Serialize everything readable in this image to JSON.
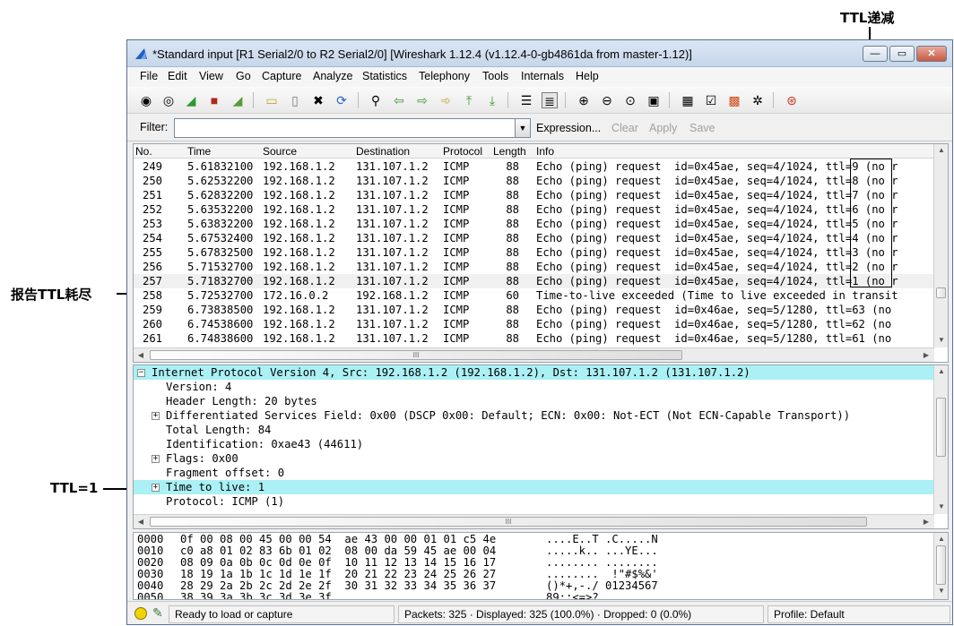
{
  "annotations": {
    "ttl_decrement": "TTL递减",
    "report_ttl_exhausted": "报告TTL耗尽",
    "ttl_equals_1": "TTL=1"
  },
  "window": {
    "title": "*Standard input   [R1 Serial2/0 to R2 Serial2/0]   [Wireshark 1.12.4  (v1.12.4-0-gb4861da from master-1.12)]",
    "minimize": "—",
    "maximize": "▭",
    "close": "✕"
  },
  "menu": [
    "File",
    "Edit",
    "View",
    "Go",
    "Capture",
    "Analyze",
    "Statistics",
    "Telephony",
    "Tools",
    "Internals",
    "Help"
  ],
  "toolbar_icons": [
    "interface-list-icon",
    "capture-options-icon",
    "start-capture-icon",
    "stop-capture-icon",
    "restart-capture-icon",
    "open-file-icon",
    "save-file-icon",
    "close-file-icon",
    "reload-icon",
    "find-packet-icon",
    "go-back-icon",
    "go-forward-icon",
    "go-to-packet-icon",
    "go-first-icon",
    "go-last-icon",
    "colorize-icon",
    "auto-scroll-icon",
    "zoom-in-icon",
    "zoom-out-icon",
    "normal-size-icon",
    "resize-columns-icon",
    "capture-filters-icon",
    "display-filters-icon",
    "coloring-rules-icon",
    "preferences-icon",
    "help-icon"
  ],
  "filter": {
    "label": "Filter:",
    "value": "",
    "expression": "Expression...",
    "clear": "Clear",
    "apply": "Apply",
    "save": "Save"
  },
  "packet_list": {
    "columns": [
      "No.",
      "Time",
      "Source",
      "Destination",
      "Protocol",
      "Length",
      "Info"
    ],
    "rows": [
      {
        "no": "249",
        "time": "5.61832100",
        "src": "192.168.1.2",
        "dst": "131.107.1.2",
        "proto": "ICMP",
        "len": "88",
        "info": "Echo (ping) request  id=0x45ae, seq=4/1024, ttl=9 (no r"
      },
      {
        "no": "250",
        "time": "5.62532200",
        "src": "192.168.1.2",
        "dst": "131.107.1.2",
        "proto": "ICMP",
        "len": "88",
        "info": "Echo (ping) request  id=0x45ae, seq=4/1024, ttl=8 (no r"
      },
      {
        "no": "251",
        "time": "5.62832200",
        "src": "192.168.1.2",
        "dst": "131.107.1.2",
        "proto": "ICMP",
        "len": "88",
        "info": "Echo (ping) request  id=0x45ae, seq=4/1024, ttl=7 (no r"
      },
      {
        "no": "252",
        "time": "5.63532200",
        "src": "192.168.1.2",
        "dst": "131.107.1.2",
        "proto": "ICMP",
        "len": "88",
        "info": "Echo (ping) request  id=0x45ae, seq=4/1024, ttl=6 (no r"
      },
      {
        "no": "253",
        "time": "5.63832200",
        "src": "192.168.1.2",
        "dst": "131.107.1.2",
        "proto": "ICMP",
        "len": "88",
        "info": "Echo (ping) request  id=0x45ae, seq=4/1024, ttl=5 (no r"
      },
      {
        "no": "254",
        "time": "5.67532400",
        "src": "192.168.1.2",
        "dst": "131.107.1.2",
        "proto": "ICMP",
        "len": "88",
        "info": "Echo (ping) request  id=0x45ae, seq=4/1024, ttl=4 (no r"
      },
      {
        "no": "255",
        "time": "5.67832500",
        "src": "192.168.1.2",
        "dst": "131.107.1.2",
        "proto": "ICMP",
        "len": "88",
        "info": "Echo (ping) request  id=0x45ae, seq=4/1024, ttl=3 (no r"
      },
      {
        "no": "256",
        "time": "5.71532700",
        "src": "192.168.1.2",
        "dst": "131.107.1.2",
        "proto": "ICMP",
        "len": "88",
        "info": "Echo (ping) request  id=0x45ae, seq=4/1024, ttl=2 (no r"
      },
      {
        "no": "257",
        "time": "5.71832700",
        "src": "192.168.1.2",
        "dst": "131.107.1.2",
        "proto": "ICMP",
        "len": "88",
        "info": "Echo (ping) request  id=0x45ae, seq=4/1024, ttl=1 (no r"
      },
      {
        "no": "258",
        "time": "5.72532700",
        "src": "172.16.0.2",
        "dst": "192.168.1.2",
        "proto": "ICMP",
        "len": "60",
        "info": "Time-to-live exceeded (Time to live exceeded in transit"
      },
      {
        "no": "259",
        "time": "6.73838500",
        "src": "192.168.1.2",
        "dst": "131.107.1.2",
        "proto": "ICMP",
        "len": "88",
        "info": "Echo (ping) request  id=0x46ae, seq=5/1280, ttl=63 (no"
      },
      {
        "no": "260",
        "time": "6.74538600",
        "src": "192.168.1.2",
        "dst": "131.107.1.2",
        "proto": "ICMP",
        "len": "88",
        "info": "Echo (ping) request  id=0x46ae, seq=5/1280, ttl=62 (no"
      },
      {
        "no": "261",
        "time": "6.74838600",
        "src": "192.168.1.2",
        "dst": "131.107.1.2",
        "proto": "ICMP",
        "len": "88",
        "info": "Echo (ping) request  id=0x46ae, seq=5/1280, ttl=61 (no"
      }
    ],
    "hscroll_grip": "III"
  },
  "details": {
    "rows": [
      {
        "indent": 0,
        "expander": "⊟",
        "text": "Internet Protocol Version 4, Src: 192.168.1.2 (192.168.1.2), Dst: 131.107.1.2 (131.107.1.2)",
        "highlight": true
      },
      {
        "indent": 1,
        "expander": "",
        "text": "Version: 4",
        "highlight": false
      },
      {
        "indent": 1,
        "expander": "",
        "text": "Header Length: 20 bytes",
        "highlight": false
      },
      {
        "indent": 1,
        "expander": "⊞",
        "text": "Differentiated Services Field: 0x00 (DSCP 0x00: Default; ECN: 0x00: Not-ECT (Not ECN-Capable Transport))",
        "highlight": false
      },
      {
        "indent": 1,
        "expander": "",
        "text": "Total Length: 84",
        "highlight": false
      },
      {
        "indent": 1,
        "expander": "",
        "text": "Identification: 0xae43 (44611)",
        "highlight": false
      },
      {
        "indent": 1,
        "expander": "⊞",
        "text": "Flags: 0x00",
        "highlight": false
      },
      {
        "indent": 1,
        "expander": "",
        "text": "Fragment offset: 0",
        "highlight": false
      },
      {
        "indent": 1,
        "expander": "⊞",
        "text": "Time to live: 1",
        "highlight": true
      },
      {
        "indent": 1,
        "expander": "",
        "text": "Protocol: ICMP (1)",
        "highlight": false
      }
    ],
    "hscroll_grip": "III"
  },
  "hex": {
    "rows": [
      {
        "offset": "0000",
        "bytes": "0f 00 08 00 45 00 00 54  ae 43 00 00 01 01 c5 4e",
        "ascii": "....E..T .C.....N"
      },
      {
        "offset": "0010",
        "bytes": "c0 a8 01 02 83 6b 01 02  08 00 da 59 45 ae 00 04",
        "ascii": ".....k.. ...YE..."
      },
      {
        "offset": "0020",
        "bytes": "08 09 0a 0b 0c 0d 0e 0f  10 11 12 13 14 15 16 17",
        "ascii": "........ ........"
      },
      {
        "offset": "0030",
        "bytes": "18 19 1a 1b 1c 1d 1e 1f  20 21 22 23 24 25 26 27",
        "ascii": "........  !\"#$%&'"
      },
      {
        "offset": "0040",
        "bytes": "28 29 2a 2b 2c 2d 2e 2f  30 31 32 33 34 35 36 37",
        "ascii": "()*+,-./ 01234567"
      },
      {
        "offset": "0050",
        "bytes": "38 39 3a 3b 3c 3d 3e 3f",
        "ascii": "89:;<=>?"
      }
    ]
  },
  "status": {
    "ready": "Ready to load or capture",
    "packets": "Packets: 325 · Displayed: 325 (100.0%) · Dropped: 0 (0.0%)",
    "profile": "Profile: Default"
  },
  "colors": {
    "highlight": "#aaf0f5",
    "shark_blue": "#1f5fbf"
  }
}
